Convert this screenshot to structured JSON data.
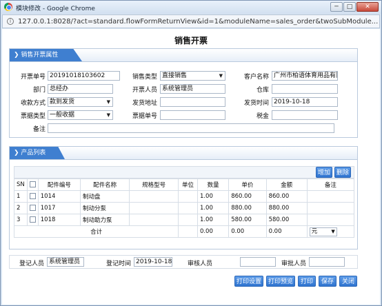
{
  "window": {
    "title": "模块修改 - Google Chrome",
    "url": "127.0.0.1:8028/?act=standard.flowFormReturnView&id=1&moduleName=sales_order&twoSubModule..."
  },
  "page": {
    "title": "销售开票"
  },
  "attributes_panel": {
    "tab": "销售开票属性",
    "fields": {
      "invoice_no_label": "开票单号",
      "invoice_no": "20191018103602",
      "sales_type_label": "销售类型",
      "sales_type": "直接销售",
      "customer_label": "客户名称",
      "customer": "广州市柏语体育用品有限",
      "dept_label": "部门",
      "dept": "总经办",
      "issuer_label": "开票人员",
      "issuer": "系统管理员",
      "warehouse_label": "仓库",
      "warehouse": "",
      "payment_label": "收款方式",
      "payment": "款到发货",
      "ship_addr_label": "发货地址",
      "ship_addr": "",
      "ship_time_label": "发货时间",
      "ship_time": "2019-10-18",
      "receipt_type_label": "票据类型",
      "receipt_type": "一般收据",
      "receipt_no_label": "票据单号",
      "receipt_no": "",
      "tax_label": "税金",
      "tax": "",
      "remark_label": "备注",
      "remark": ""
    }
  },
  "products_panel": {
    "tab": "产品列表",
    "add_button": "增加",
    "delete_button": "删除",
    "headers": [
      "SN",
      "",
      "配件编号",
      "配件名称",
      "规格型号",
      "单位",
      "数量",
      "单价",
      "金额",
      "备注"
    ],
    "rows": [
      {
        "sn": "1",
        "code": "1014",
        "name": "制动盘",
        "spec": "",
        "unit": "",
        "qty": "1.00",
        "price": "860.00",
        "amount": "860.00",
        "note": ""
      },
      {
        "sn": "2",
        "code": "1017",
        "name": "制动分泵",
        "spec": "",
        "unit": "",
        "qty": "1.00",
        "price": "880.00",
        "amount": "880.00",
        "note": ""
      },
      {
        "sn": "3",
        "code": "1018",
        "name": "制动助力泵",
        "spec": "",
        "unit": "",
        "qty": "1.00",
        "price": "580.00",
        "amount": "580.00",
        "note": ""
      }
    ],
    "total_label": "合计",
    "total_qty": "0.00",
    "total_price": "0.00",
    "total_amount": "0.00",
    "currency": "元"
  },
  "footer": {
    "registrar_label": "登记人员",
    "registrar": "系统管理员",
    "reg_time_label": "登记时间",
    "reg_time": "2019-10-18",
    "reviewer_label": "审核人员",
    "reviewer": "",
    "approver_label": "审批人员",
    "approver": ""
  },
  "actions": [
    "打印设置",
    "打印预览",
    "打印",
    "保存",
    "关闭"
  ]
}
